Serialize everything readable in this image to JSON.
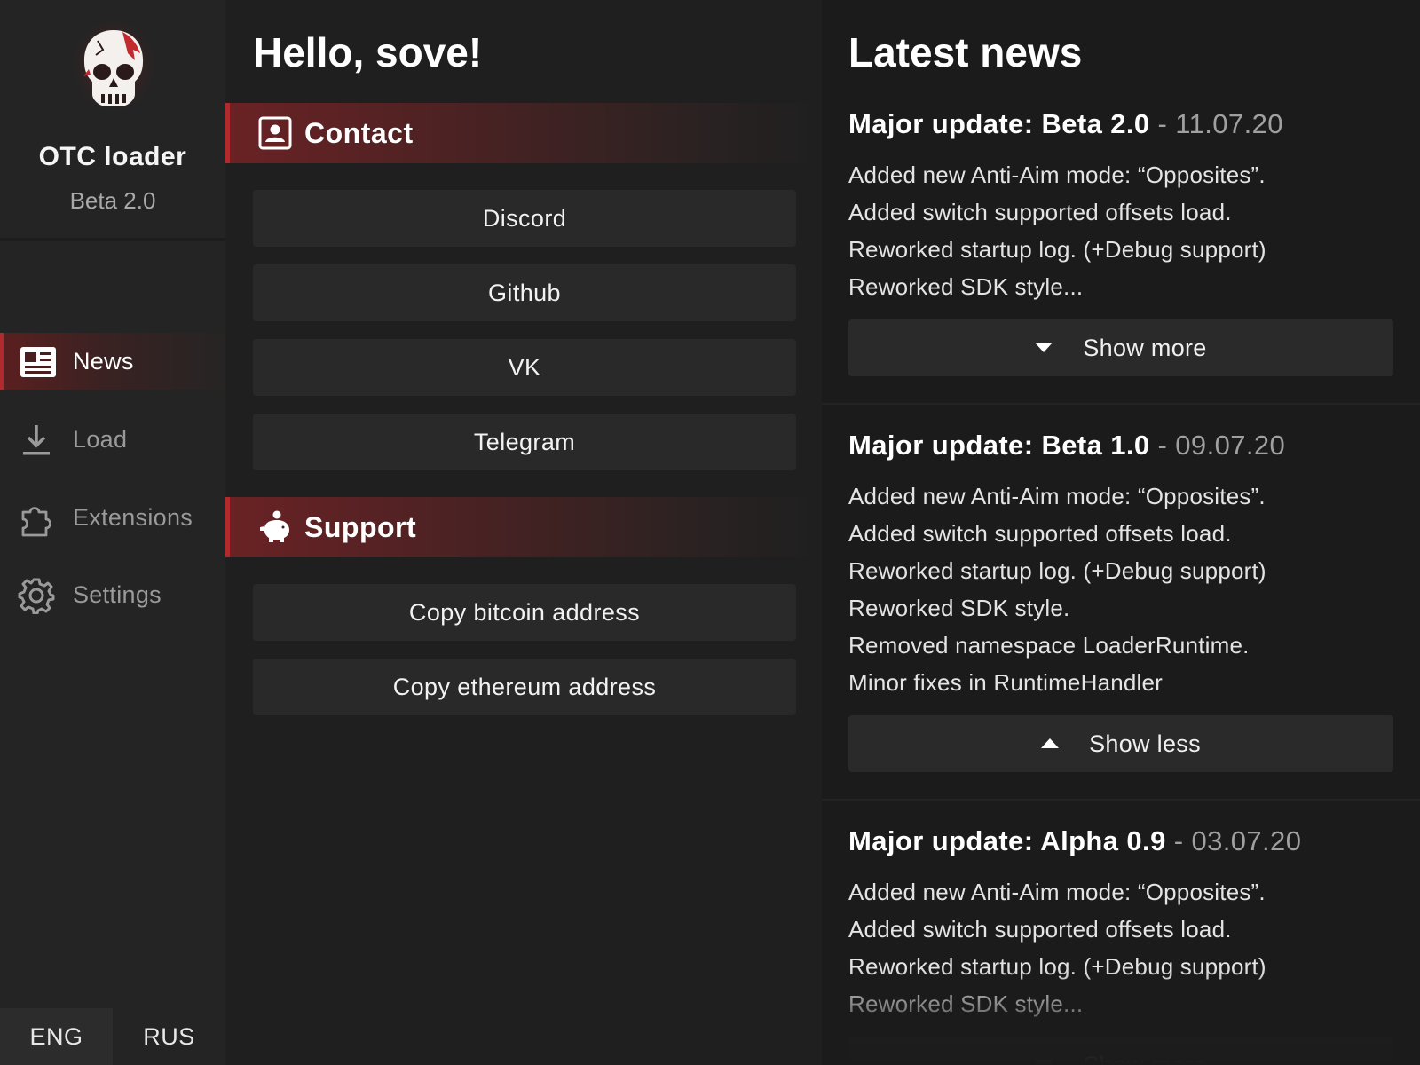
{
  "sidebar": {
    "brand_title": "OTC loader",
    "brand_subtitle": "Beta 2.0",
    "logo_icon": "skull-logo",
    "nav": [
      {
        "label": "News",
        "icon": "newspaper-icon",
        "active": true
      },
      {
        "label": "Load",
        "icon": "download-icon",
        "active": false
      },
      {
        "label": "Extensions",
        "icon": "puzzle-icon",
        "active": false
      },
      {
        "label": "Settings",
        "icon": "gear-icon",
        "active": false
      }
    ],
    "languages": [
      {
        "label": "ENG",
        "selected": true
      },
      {
        "label": "RUS",
        "selected": false
      }
    ]
  },
  "main": {
    "greeting": "Hello, sove!",
    "contact": {
      "title": "Contact",
      "icon": "contact-card-icon",
      "buttons": [
        "Discord",
        "Github",
        "VK",
        "Telegram"
      ]
    },
    "support": {
      "title": "Support",
      "icon": "piggy-bank-icon",
      "buttons": [
        "Copy bitcoin address",
        "Copy ethereum address"
      ]
    }
  },
  "news": {
    "heading": "Latest news",
    "articles": [
      {
        "title": "Major update: Beta 2.0",
        "date": " - 11.07.20",
        "lines": [
          "Added new Anti-Aim mode: “Opposites”.",
          "Added switch supported offsets load.",
          "Reworked startup log. (+Debug support)",
          "Reworked SDK style..."
        ],
        "toggle_label": "Show more",
        "expanded": false
      },
      {
        "title": "Major update: Beta 1.0",
        "date": " - 09.07.20",
        "lines": [
          "Added new Anti-Aim mode: “Opposites”.",
          "Added switch supported offsets load.",
          "Reworked startup log. (+Debug support)",
          "Reworked SDK style.",
          "Removed namespace LoaderRuntime.",
          "Minor fixes in RuntimeHandler"
        ],
        "toggle_label": "Show less",
        "expanded": true
      },
      {
        "title": "Major update: Alpha 0.9",
        "date": " - 03.07.20",
        "lines": [
          "Added new Anti-Aim mode: “Opposites”.",
          "Added switch supported offsets load.",
          "Reworked startup log. (+Debug support)",
          "Reworked SDK style..."
        ],
        "toggle_label": "Show more",
        "expanded": false
      }
    ]
  },
  "colors": {
    "accent": "#b02a2e",
    "background": "#1f1f1f",
    "sidebar": "#242424",
    "button": "#292929",
    "muted_text": "#9a9a9a"
  }
}
